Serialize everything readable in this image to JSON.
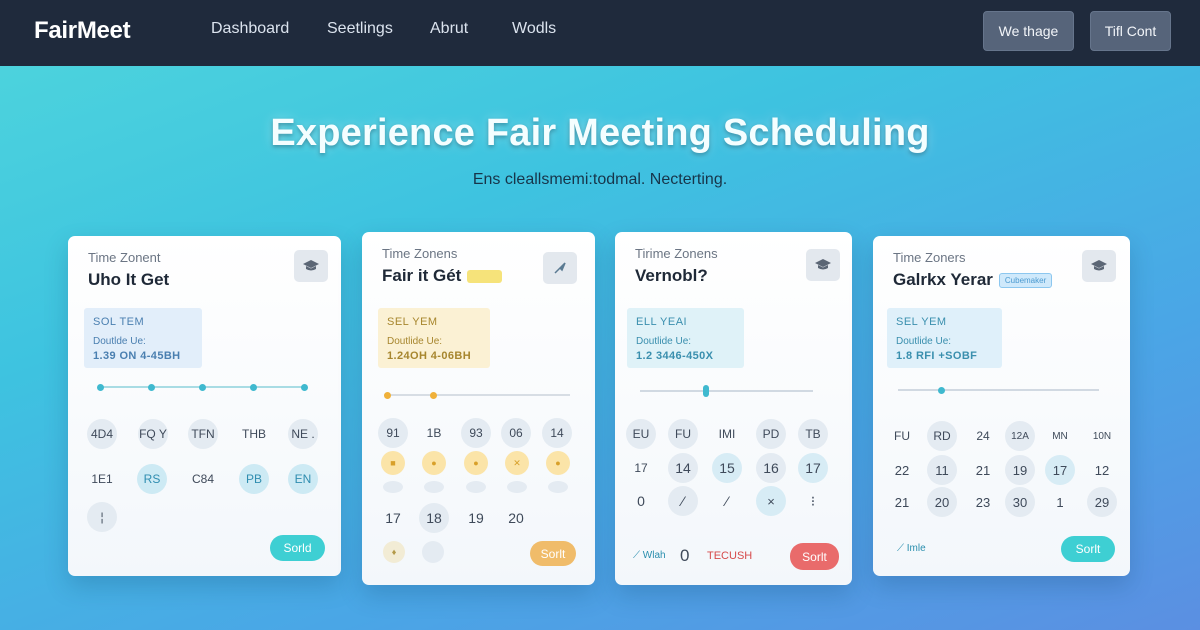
{
  "header": {
    "brand": "FairMeet",
    "nav": [
      "Dashboard",
      "Seetlings",
      "Abrut",
      "Wodls"
    ],
    "buttons": [
      "We thage",
      "Tifl Cont"
    ]
  },
  "hero": {
    "title": "Experience Fair Meeting Scheduling",
    "subtitle": "Ens cleallsmemi:todmal. Necterting."
  },
  "cards": [
    {
      "label": "Time Zonent",
      "name": "Uho It Get",
      "tag": "",
      "icon": "graduation-cap-icon",
      "info": {
        "line1": "SOL TEM",
        "line2": "Doutlde Ue:",
        "line3": "1.39 ON 4-45BH"
      },
      "chips": [
        [
          "4D4",
          "FQ Y",
          "TFN",
          "THB",
          "NE ."
        ],
        [
          "1E1",
          "RS",
          "C84",
          "PB",
          "EN"
        ],
        [
          "¦"
        ]
      ],
      "button": "Sorld",
      "footer_left": "",
      "footer_mid": ""
    },
    {
      "label": "Time Zonens",
      "name": "Fair it Gét",
      "tag": "■■■■■",
      "icon": "pin-icon",
      "info": {
        "line1": "SEL YEM",
        "line2": "Doutlide Ue:",
        "line3": "1.24OH 4-06BH"
      },
      "chips": [
        [
          "91",
          "1B",
          "93",
          "06",
          "14"
        ],
        [
          "■",
          "●",
          "●",
          "✕",
          "●"
        ],
        [
          "",
          "",
          "",
          "",
          ""
        ],
        [
          "17",
          "18",
          "19",
          "20"
        ],
        [
          "♦",
          ""
        ]
      ],
      "button": "Sorlt",
      "footer_left": "",
      "footer_mid": ""
    },
    {
      "label": "Tirime Zonens",
      "name": "Vernobl?",
      "tag": "",
      "icon": "graduation-cap-icon",
      "info": {
        "line1": "ELL YEAI",
        "line2": "Doutlide Ue:",
        "line3": "1.2 3446-450X"
      },
      "chips": [
        [
          "EU",
          "FU",
          "IMI",
          "PD",
          "TB"
        ],
        [
          "17",
          "14",
          "15",
          "16",
          "17"
        ],
        [
          "0",
          "⁄",
          "⁄",
          "×",
          "⁝"
        ]
      ],
      "button": "Sorlt",
      "footer_left": "⟋ Wlah",
      "footer_mid": "0",
      "footer_right": "TECUSH"
    },
    {
      "label": "Time Zoners",
      "name": "Galrkx Yerar",
      "tag": "Cubemaker",
      "icon": "graduation-cap-icon",
      "info": {
        "line1": "SEL YEM",
        "line2": "Doutlide Ue:",
        "line3": "1.8 RFI +SOBF"
      },
      "chips": [
        [
          "FU",
          "RD",
          "24",
          "12A",
          "MN",
          "10N"
        ],
        [
          "22",
          "11",
          "21",
          "19",
          "17",
          "12"
        ],
        [
          "21",
          "20",
          "23",
          "30",
          "1",
          "29"
        ]
      ],
      "button": "Sorlt",
      "footer_left": "⟋ Imle",
      "footer_mid": ""
    }
  ],
  "colors": {
    "header_bg": "#1f2a3c",
    "teal": "#3ecfd3",
    "yellow": "#f2c66a",
    "red": "#e96b6b"
  }
}
